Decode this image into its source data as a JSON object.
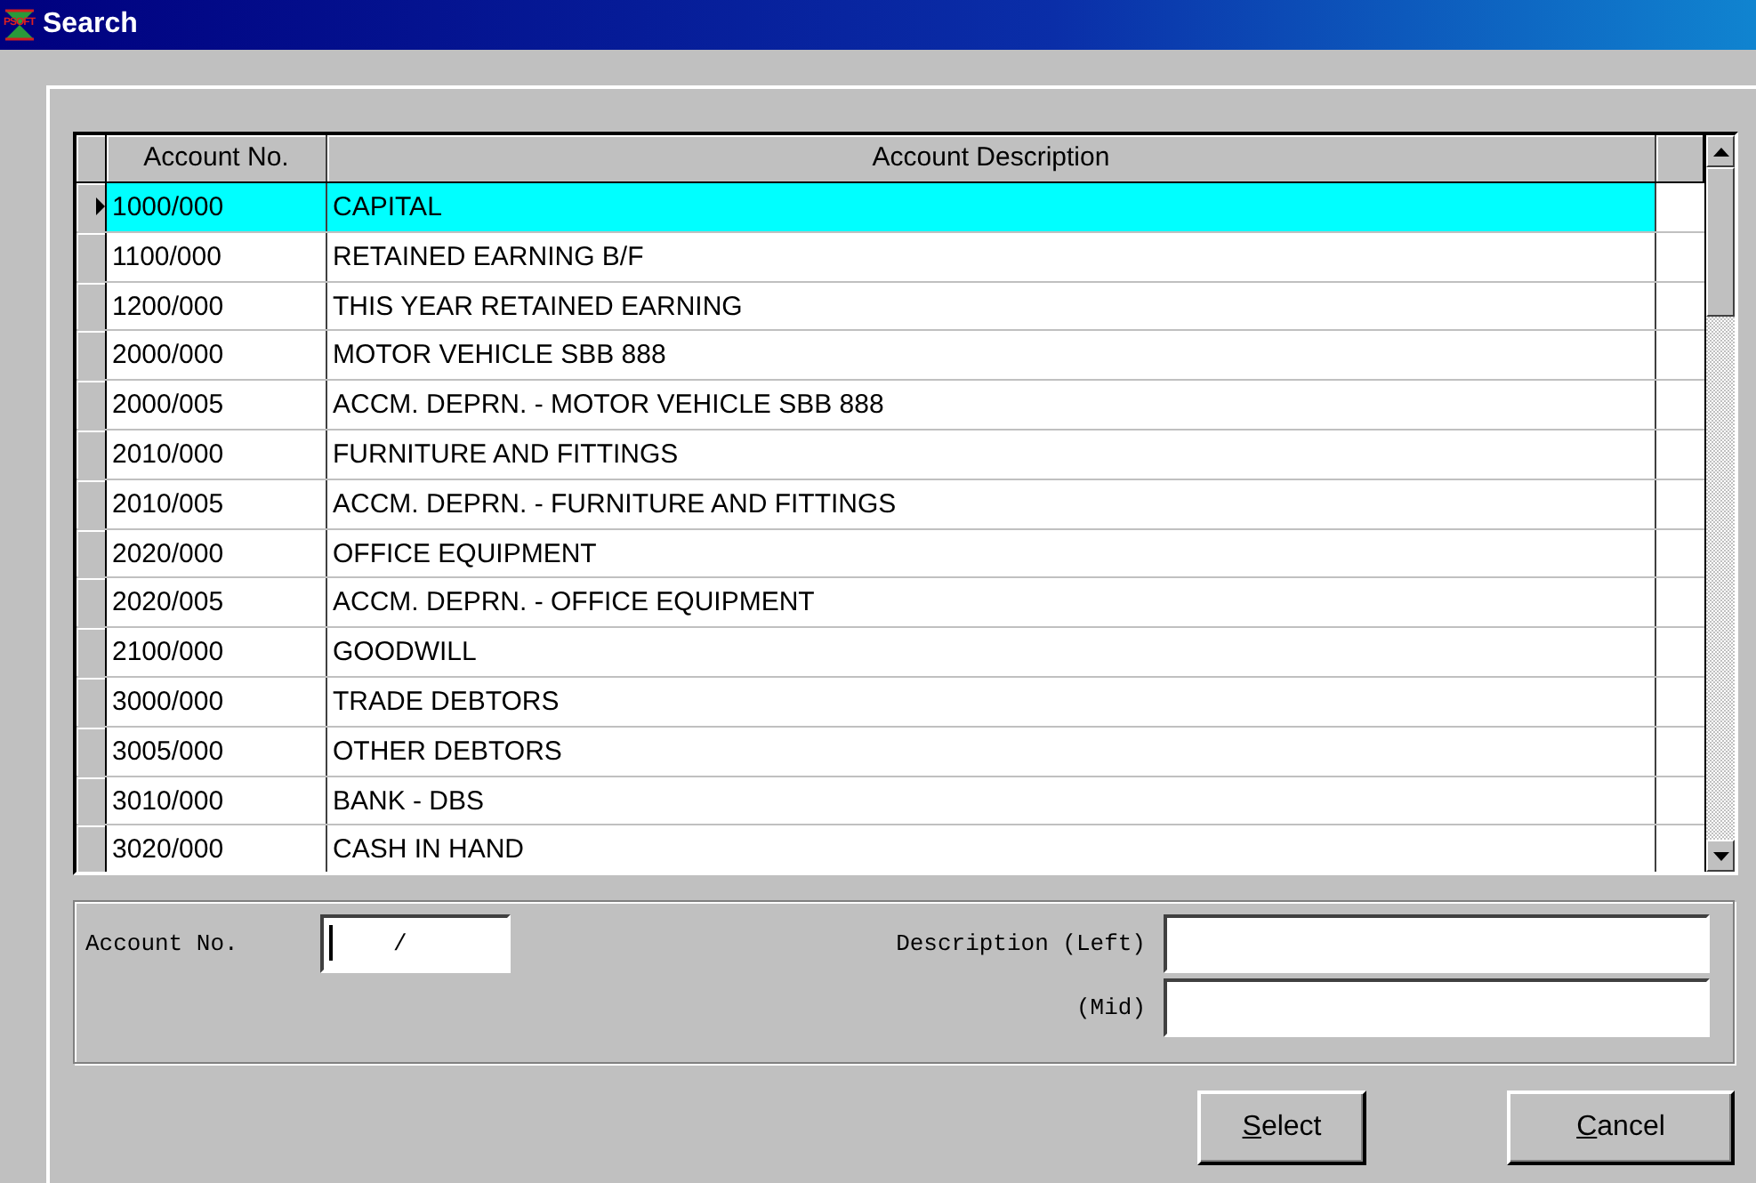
{
  "window": {
    "title": "Search",
    "logo_text": "PSOFT"
  },
  "table": {
    "columns": [
      "Account No.",
      "Account Description"
    ],
    "rows": [
      {
        "account": "1000/000",
        "description": "CAPITAL",
        "selected": true
      },
      {
        "account": "1100/000",
        "description": "RETAINED EARNING B/F",
        "selected": false
      },
      {
        "account": "1200/000",
        "description": "THIS YEAR RETAINED EARNING",
        "selected": false
      },
      {
        "account": "2000/000",
        "description": "MOTOR VEHICLE SBB 888",
        "selected": false
      },
      {
        "account": "2000/005",
        "description": "ACCM. DEPRN. - MOTOR VEHICLE SBB 888",
        "selected": false
      },
      {
        "account": "2010/000",
        "description": "FURNITURE AND FITTINGS",
        "selected": false
      },
      {
        "account": "2010/005",
        "description": "ACCM. DEPRN. - FURNITURE AND FITTINGS",
        "selected": false
      },
      {
        "account": "2020/000",
        "description": "OFFICE EQUIPMENT",
        "selected": false
      },
      {
        "account": "2020/005",
        "description": "ACCM. DEPRN. - OFFICE EQUIPMENT",
        "selected": false
      },
      {
        "account": "2100/000",
        "description": "GOODWILL",
        "selected": false
      },
      {
        "account": "3000/000",
        "description": "TRADE DEBTORS",
        "selected": false
      },
      {
        "account": "3005/000",
        "description": "OTHER DEBTORS",
        "selected": false
      },
      {
        "account": "3010/000",
        "description": "BANK - DBS",
        "selected": false
      },
      {
        "account": "3020/000",
        "description": "CASH IN HAND",
        "selected": false
      }
    ]
  },
  "filters": {
    "account_label": "Account No.",
    "account_value": "/",
    "left_label": "Description (Left)",
    "mid_label": "(Mid)"
  },
  "buttons": [
    "Select",
    "Cancel"
  ]
}
